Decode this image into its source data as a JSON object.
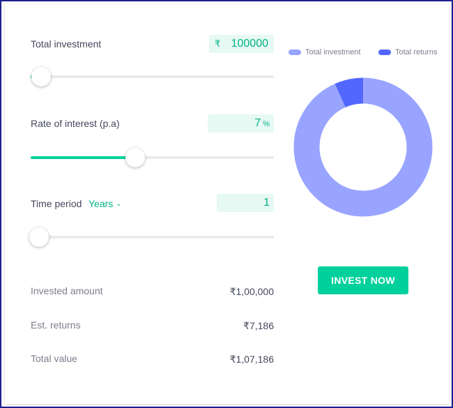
{
  "investment": {
    "label": "Total investment",
    "currency_symbol": "₹",
    "value": "100000",
    "slider_fraction": 0.0
  },
  "interest": {
    "label": "Rate of interest (p.a)",
    "value": "7",
    "unit": "%",
    "slider_fraction": 0.43
  },
  "period": {
    "label": "Time period",
    "unit_selected": "Years",
    "value": "1",
    "slider_fraction": 0.0
  },
  "summary": [
    {
      "label": "Invested amount",
      "value": "₹1,00,000"
    },
    {
      "label": "Est. returns",
      "value": "₹7,186"
    },
    {
      "label": "Total value",
      "value": "₹1,07,186"
    }
  ],
  "legend": {
    "invested_label": "Total investment",
    "returns_label": "Total returns"
  },
  "colors": {
    "accent": "#00d09c",
    "invested": "#98a4ff",
    "returns": "#5367ff",
    "value_bg": "#e6f9f3"
  },
  "chart": {
    "invested": 100000,
    "returns": 7186
  },
  "cta_label": "INVEST NOW"
}
